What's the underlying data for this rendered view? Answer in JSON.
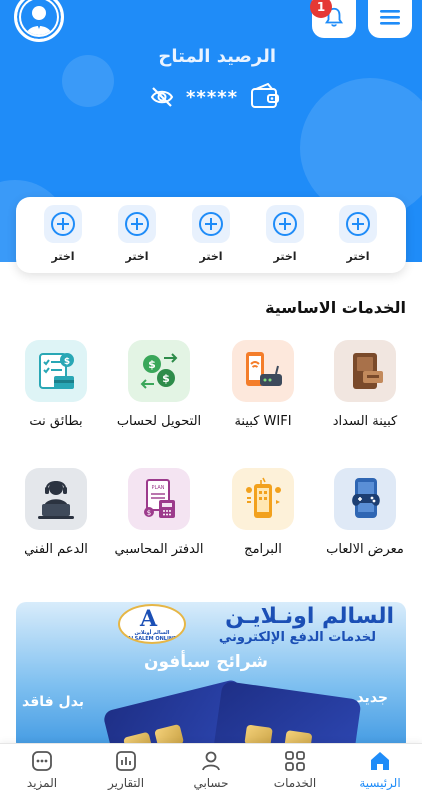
{
  "header": {
    "balance_title": "الرصيد المتاح",
    "balance_value": "*****",
    "notification_count": "1",
    "accent_color": "#1f8cf8"
  },
  "quick_slots": {
    "label": "اختر",
    "count": 5
  },
  "services_section": {
    "title": "الخدمات الاساسية",
    "items": [
      {
        "label": "كبينة السداد",
        "icon": "payment-cabin-icon"
      },
      {
        "label": "كبينة WIFI",
        "icon": "wifi-router-icon"
      },
      {
        "label": "التحويل لحساب",
        "icon": "money-transfer-icon"
      },
      {
        "label": "بطائق نت",
        "icon": "net-cards-icon"
      },
      {
        "label": "معرض الالعاب",
        "icon": "gamepad-icon"
      },
      {
        "label": "البرامج",
        "icon": "apps-phone-icon"
      },
      {
        "label": "الدفتر المحاسبي",
        "icon": "ledger-icon"
      },
      {
        "label": "الدعم الفني",
        "icon": "support-agent-icon"
      }
    ]
  },
  "banner": {
    "title": "السالم اونـلايـن",
    "subtitle": "لخدمات الدفع الإلكتروني",
    "chips_text": "شرائح سبأفون",
    "new_text": "جديد",
    "lost_text": "بدل فاقد",
    "logo_letter": "A",
    "logo_caption": "السالم أونلاين",
    "logo_caption_en": "ALSALEM ONLINE"
  },
  "bottom_nav": {
    "items": [
      {
        "label": "الرئيسية",
        "icon": "home-icon",
        "active": true
      },
      {
        "label": "الخدمات",
        "icon": "grid-icon",
        "active": false
      },
      {
        "label": "حسابي",
        "icon": "user-icon",
        "active": false
      },
      {
        "label": "التقارير",
        "icon": "reports-icon",
        "active": false
      },
      {
        "label": "المزيد",
        "icon": "more-icon",
        "active": false
      }
    ]
  }
}
